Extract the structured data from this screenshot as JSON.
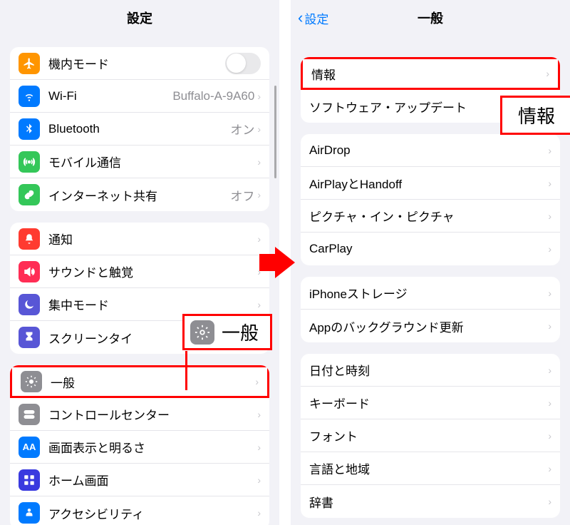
{
  "left": {
    "title": "設定",
    "group1": [
      {
        "label": "機内モード",
        "icon": "airplane",
        "bg": "#ff9500",
        "type": "toggle"
      },
      {
        "label": "Wi-Fi",
        "icon": "wifi",
        "bg": "#007aff",
        "value": "Buffalo-A-9A60"
      },
      {
        "label": "Bluetooth",
        "icon": "bluetooth",
        "bg": "#007aff",
        "value": "オン"
      },
      {
        "label": "モバイル通信",
        "icon": "antenna",
        "bg": "#34c759",
        "value": ""
      },
      {
        "label": "インターネット共有",
        "icon": "link",
        "bg": "#34c759",
        "value": "オフ"
      }
    ],
    "group2": [
      {
        "label": "通知",
        "icon": "bell",
        "bg": "#ff3b30"
      },
      {
        "label": "サウンドと触覚",
        "icon": "speaker",
        "bg": "#ff2d55"
      },
      {
        "label": "集中モード",
        "icon": "moon",
        "bg": "#5856d6"
      },
      {
        "label": "スクリーンタイ",
        "icon": "hourglass",
        "bg": "#5856d6"
      }
    ],
    "group3": [
      {
        "label": "一般",
        "icon": "gear",
        "bg": "#8e8e93"
      },
      {
        "label": "コントロールセンター",
        "icon": "switches",
        "bg": "#8e8e93"
      },
      {
        "label": "画面表示と明るさ",
        "icon": "aa",
        "bg": "#007aff"
      },
      {
        "label": "ホーム画面",
        "icon": "grid",
        "bg": "#3a3adf"
      },
      {
        "label": "アクセシビリティ",
        "icon": "person",
        "bg": "#007aff"
      }
    ],
    "callout_label": "一般"
  },
  "right": {
    "back": "設定",
    "title": "一般",
    "group1": [
      {
        "label": "情報"
      },
      {
        "label": "ソフトウェア・アップデート"
      }
    ],
    "group2": [
      {
        "label": "AirDrop"
      },
      {
        "label": "AirPlayとHandoff"
      },
      {
        "label": "ピクチャ・イン・ピクチャ"
      },
      {
        "label": "CarPlay"
      }
    ],
    "group3": [
      {
        "label": "iPhoneストレージ"
      },
      {
        "label": "Appのバックグラウンド更新"
      }
    ],
    "group4": [
      {
        "label": "日付と時刻"
      },
      {
        "label": "キーボード"
      },
      {
        "label": "フォント"
      },
      {
        "label": "言語と地域"
      },
      {
        "label": "辞書"
      }
    ],
    "callout_label": "情報"
  }
}
